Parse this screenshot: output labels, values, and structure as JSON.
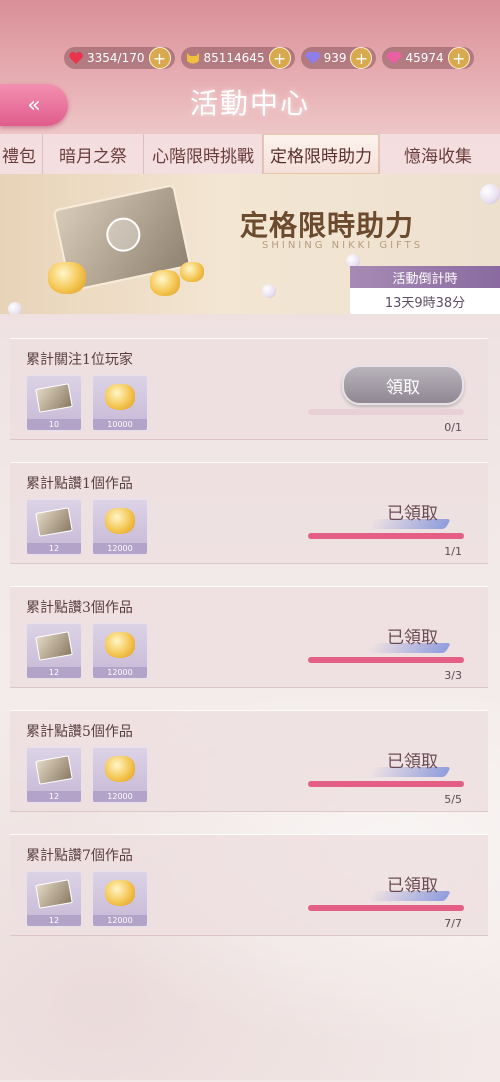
{
  "status": {
    "stamina": "3354/170",
    "gold": "85114645",
    "diamond": "939",
    "pink_diamond": "45974"
  },
  "header": {
    "title": "活動中心",
    "back_icon": "«"
  },
  "tabs": [
    {
      "label": "禮包"
    },
    {
      "label": "暗月之祭"
    },
    {
      "label": "心階限時挑戰"
    },
    {
      "label": "定格限時助力",
      "active": true
    },
    {
      "label": "憶海收集"
    }
  ],
  "banner": {
    "title": "定格限時助力",
    "subtitle": "SHINING NIKKI GIFTS",
    "countdown_label": "活動倒計時",
    "countdown_value": "13天9時38分"
  },
  "tasks": [
    {
      "title": "累計關注1位玩家",
      "reward1_qty": "10",
      "reward2_qty": "10000",
      "state": "claim",
      "button": "領取",
      "progress": "0/1",
      "fill": 0
    },
    {
      "title": "累計點讚1個作品",
      "reward1_qty": "12",
      "reward2_qty": "12000",
      "state": "claimed",
      "button": "已領取",
      "progress": "1/1",
      "fill": 1
    },
    {
      "title": "累計點讚3個作品",
      "reward1_qty": "12",
      "reward2_qty": "12000",
      "state": "claimed",
      "button": "已領取",
      "progress": "3/3",
      "fill": 1
    },
    {
      "title": "累計點讚5個作品",
      "reward1_qty": "12",
      "reward2_qty": "12000",
      "state": "claimed",
      "button": "已領取",
      "progress": "5/5",
      "fill": 1
    },
    {
      "title": "累計點讚7個作品",
      "reward1_qty": "12",
      "reward2_qty": "12000",
      "state": "claimed",
      "button": "已領取",
      "progress": "7/7",
      "fill": 1
    }
  ],
  "colors": {
    "accent": "#e45f86",
    "tab_bg": "#f5e1e2",
    "countdown": "#8a6aa0"
  }
}
